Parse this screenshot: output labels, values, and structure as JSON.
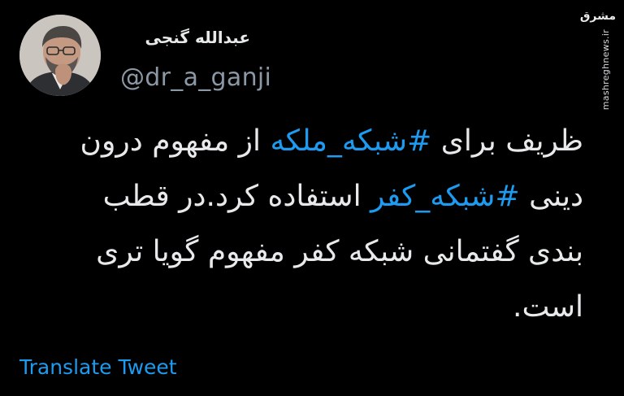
{
  "user": {
    "display_name": "عبدالله گنجی",
    "handle": "@dr_a_ganji"
  },
  "watermark": {
    "logo_text": "مشرق",
    "url": "mashreghnews.ir"
  },
  "tweet": {
    "part1": "ظریف برای ",
    "hashtag1": "#شبکه_ملکه",
    "part2": " از مفهوم درون دینی ",
    "hashtag2": "#شبکه_کفر",
    "part3": " استفاده کرد.در قطب بندی گفتمانی شبکه کفر مفهوم گویا تری است."
  },
  "actions": {
    "translate_label": "Translate Tweet"
  },
  "colors": {
    "background": "#000000",
    "text": "#e7e9ea",
    "secondary": "#8b98a5",
    "accent": "#1d9bf0"
  }
}
